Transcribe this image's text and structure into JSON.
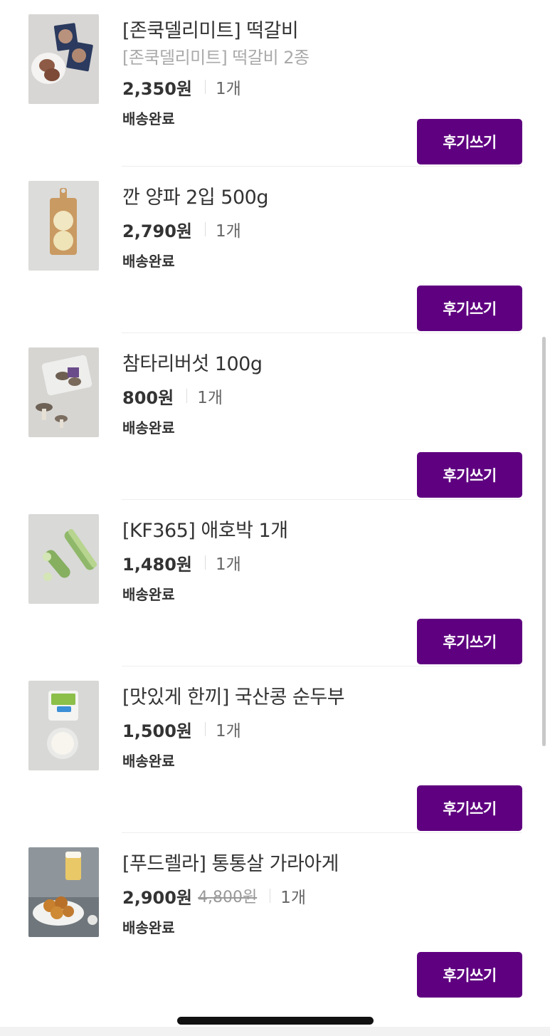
{
  "orders": [
    {
      "name": "[존쿡델리미트] 떡갈비",
      "option": "[존쿡델리미트] 떡갈비 2종",
      "price": "2,350원",
      "original_price": null,
      "quantity": "1개",
      "status": "배송완료",
      "button_label": "후기쓰기",
      "thumbnail_icon": "tteokgalbi-thumbnail"
    },
    {
      "name": "깐 양파 2입 500g",
      "option": null,
      "price": "2,790원",
      "original_price": null,
      "quantity": "1개",
      "status": "배송완료",
      "button_label": "후기쓰기",
      "thumbnail_icon": "onion-thumbnail"
    },
    {
      "name": "참타리버섯 100g",
      "option": null,
      "price": "800원",
      "original_price": null,
      "quantity": "1개",
      "status": "배송완료",
      "button_label": "후기쓰기",
      "thumbnail_icon": "mushroom-thumbnail"
    },
    {
      "name": "[KF365] 애호박 1개",
      "option": null,
      "price": "1,480원",
      "original_price": null,
      "quantity": "1개",
      "status": "배송완료",
      "button_label": "후기쓰기",
      "thumbnail_icon": "zucchini-thumbnail"
    },
    {
      "name": "[맛있게 한끼] 국산콩 순두부",
      "option": null,
      "price": "1,500원",
      "original_price": null,
      "quantity": "1개",
      "status": "배송완료",
      "button_label": "후기쓰기",
      "thumbnail_icon": "soft-tofu-thumbnail"
    },
    {
      "name": "[푸드렐라] 통통살 가라아게",
      "option": null,
      "price": "2,900원",
      "original_price": "4,800원",
      "quantity": "1개",
      "status": "배송완료",
      "button_label": "후기쓰기",
      "thumbnail_icon": "karaage-thumbnail"
    }
  ],
  "colors": {
    "accent": "#5f0080",
    "text": "#333333",
    "muted": "#aaaaaa"
  }
}
